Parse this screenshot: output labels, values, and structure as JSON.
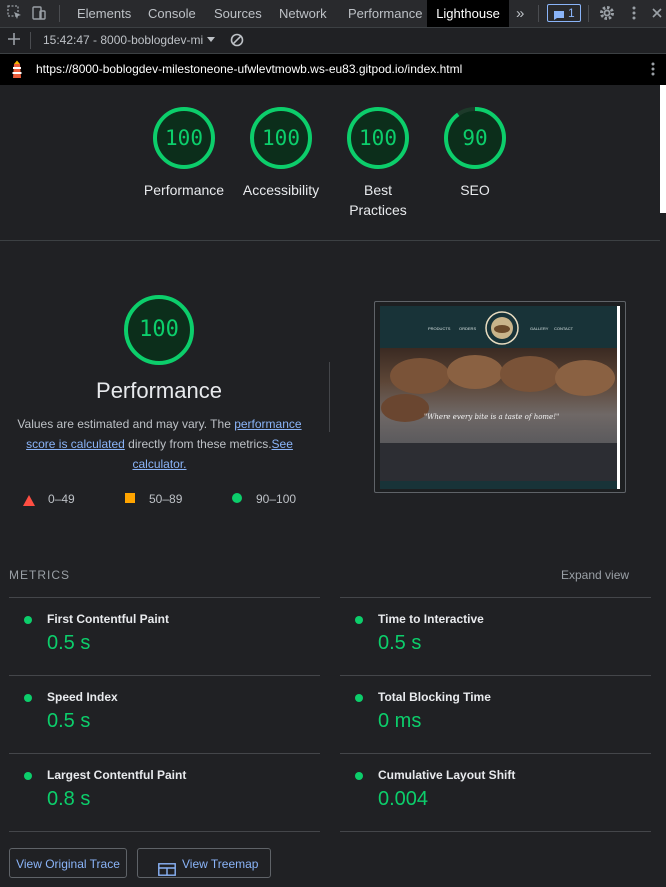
{
  "devtools": {
    "tabs": [
      "Elements",
      "Console",
      "Sources",
      "Network",
      "Performance",
      "Lighthouse"
    ],
    "more_tabs_glyph": "»",
    "issues_count": "1",
    "report_select": "15:42:47 - 8000-boblogdev-mi",
    "url": "https://8000-boblogdev-milestoneone-ufwlevtmowb.ws-eu83.gitpod.io/index.html"
  },
  "scores": [
    {
      "label": "Performance",
      "value": "100",
      "score": 100
    },
    {
      "label": "Accessibility",
      "value": "100",
      "score": 100
    },
    {
      "label": "Best",
      "label2": "Practices",
      "value": "100",
      "score": 100
    },
    {
      "label": "SEO",
      "value": "90",
      "score": 90
    }
  ],
  "main": {
    "score": "100",
    "title": "Performance",
    "desc_pre": "Values are estimated and may vary. The ",
    "desc_link1a": "performance",
    "desc_link1b": "score is calculated",
    "desc_mid": " directly from these metrics.",
    "desc_link2a": "See",
    "desc_link2b": "calculator."
  },
  "legend": [
    {
      "range": "0–49",
      "color": "#ff4e42"
    },
    {
      "range": "50–89",
      "color": "#ffa400"
    },
    {
      "range": "90–100",
      "color": "#0cce6b"
    }
  ],
  "screenshot": {
    "nav_left": [
      "PRODUCTS",
      "ORDERS"
    ],
    "nav_right": [
      "GALLERY",
      "CONTACT"
    ],
    "tagline": "\"Where every bite is a taste of home!\""
  },
  "metrics_section": {
    "heading": "METRICS",
    "expand": "Expand view"
  },
  "metrics": [
    {
      "title": "First Contentful Paint",
      "value": "0.5 s"
    },
    {
      "title": "Time to Interactive",
      "value": "0.5 s"
    },
    {
      "title": "Speed Index",
      "value": "0.5 s"
    },
    {
      "title": "Total Blocking Time",
      "value": "0 ms"
    },
    {
      "title": "Largest Contentful Paint",
      "value": "0.8 s"
    },
    {
      "title": "Cumulative Layout Shift",
      "value": "0.004"
    }
  ],
  "buttons": {
    "trace": "View Original Trace",
    "treemap": "View Treemap"
  },
  "colors": {
    "pass": "#0cce6b",
    "link": "#8ab4f8",
    "background": "#202124"
  }
}
